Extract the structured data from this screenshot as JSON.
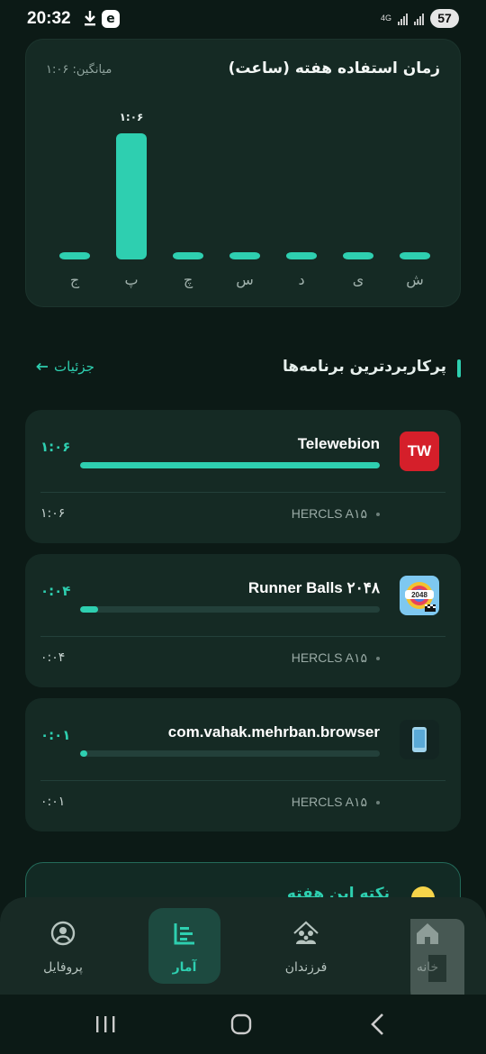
{
  "status_bar": {
    "time": "20:32",
    "network": "4G",
    "battery": "57"
  },
  "chart_card": {
    "title": "زمان استفاده هفته (ساعت)",
    "average": "میانگین: ۱:۰۶"
  },
  "chart_data": {
    "type": "bar",
    "categories": [
      "ش",
      "ی",
      "د",
      "س",
      "چ",
      "پ",
      "ج"
    ],
    "values": [
      0,
      0,
      0,
      0,
      0,
      1.1,
      0
    ],
    "value_labels": [
      "",
      "",
      "",
      "",
      "",
      "۱:۰۶",
      ""
    ],
    "direction": "rtl",
    "bar_color": "#2ecfb0",
    "grid": false
  },
  "section": {
    "title": "پرکاربردترین برنامه‌ها",
    "details": "جزئیات"
  },
  "apps": [
    {
      "name": "Telewebion",
      "icon": "telewebion-icon",
      "time": "۱:۰۶",
      "progress": 1.0,
      "device": "HERCLS A۱۵",
      "device_time": "۱:۰۶"
    },
    {
      "name": "Runner Balls ۲۰۴۸",
      "icon": "runner-balls-icon",
      "time": "۰:۰۴",
      "progress": 0.06,
      "device": "HERCLS A۱۵",
      "device_time": "۰:۰۴"
    },
    {
      "name": "com.vahak.mehrban.browser",
      "icon": "phone-app-icon",
      "time": "۰:۰۱",
      "progress": 0.0,
      "device": "HERCLS A۱۵",
      "device_time": "۰:۰۱"
    }
  ],
  "tip": {
    "title": "نکته این هفته"
  },
  "bottom_nav": [
    {
      "label": "خانه",
      "icon": "home-icon",
      "active": false
    },
    {
      "label": "فرزندان",
      "icon": "family-icon",
      "active": false
    },
    {
      "label": "آمار",
      "icon": "stats-icon",
      "active": true
    },
    {
      "label": "پروفایل",
      "icon": "profile-icon",
      "active": false
    }
  ],
  "colors": {
    "accent": "#2ecfb0",
    "background": "#0c1a16",
    "card": "#152a24"
  }
}
